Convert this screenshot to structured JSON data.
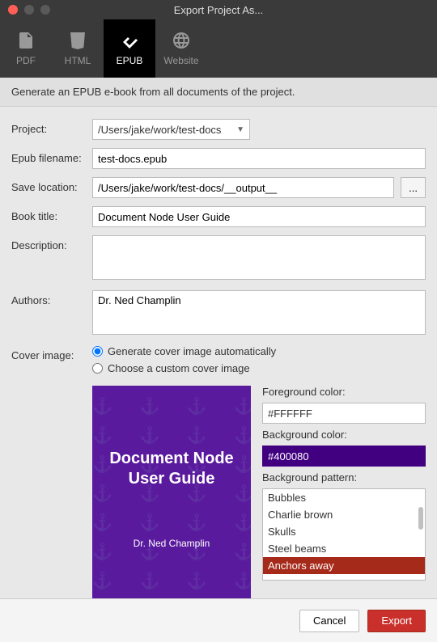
{
  "window": {
    "title": "Export Project As..."
  },
  "tabs": {
    "pdf": "PDF",
    "html": "HTML",
    "epub": "EPUB",
    "website": "Website"
  },
  "description": "Generate an EPUB e-book from all documents of the project.",
  "labels": {
    "project": "Project:",
    "epub_filename": "Epub filename:",
    "save_location": "Save location:",
    "book_title": "Book title:",
    "desc": "Description:",
    "authors": "Authors:",
    "cover_image": "Cover image:",
    "fg_color": "Foreground color:",
    "bg_color": "Background color:",
    "bg_pattern": "Background pattern:"
  },
  "values": {
    "project": "/Users/jake/work/test-docs",
    "epub_filename": "test-docs.epub",
    "save_location": "/Users/jake/work/test-docs/__output__",
    "book_title": "Document Node User Guide",
    "description": "",
    "authors": "Dr. Ned Champlin",
    "fg_color": "#FFFFFF",
    "bg_color": "#400080"
  },
  "browse_label": "...",
  "cover_options": {
    "auto": "Generate cover image automatically",
    "custom": "Choose a custom cover image"
  },
  "cover_preview": {
    "title_line1": "Document Node",
    "title_line2": "User Guide",
    "author": "Dr. Ned Champlin"
  },
  "patterns": [
    "Bubbles",
    "Charlie brown",
    "Skulls",
    "Steel beams",
    "Anchors away"
  ],
  "selected_pattern": "Anchors away",
  "buttons": {
    "cancel": "Cancel",
    "export": "Export"
  }
}
